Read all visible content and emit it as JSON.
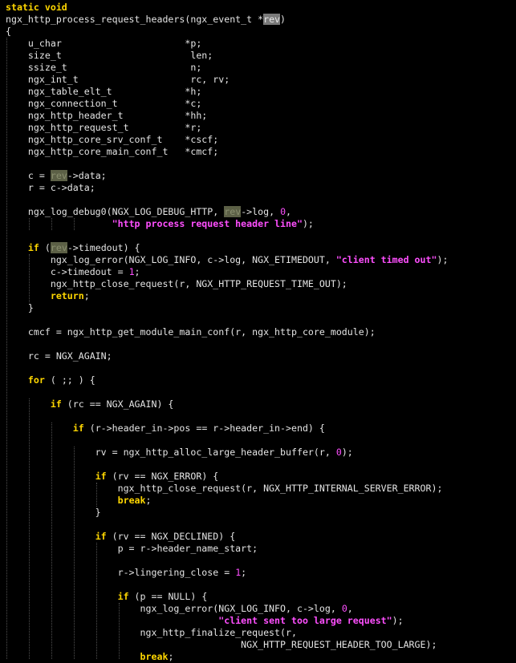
{
  "editor": {
    "language": "c",
    "colors": {
      "background": "#000000",
      "text": "#e4e4e4",
      "keyword": "#ffd700",
      "literal": "#ff4fff",
      "match_highlight": "#5c6046",
      "selection": "#7a7a7a"
    },
    "lines": [
      [
        [
          "static void",
          "kw"
        ]
      ],
      [
        [
          "ngx_http_process_request_headers(ngx_event_t *",
          ""
        ],
        [
          "rev",
          "sel"
        ],
        [
          ")",
          ""
        ]
      ],
      [
        [
          "{",
          ""
        ]
      ],
      [
        [
          "    u_char                      *p;",
          ""
        ]
      ],
      [
        [
          "    size_t                       len;",
          ""
        ]
      ],
      [
        [
          "    ssize_t                      n;",
          ""
        ]
      ],
      [
        [
          "    ngx_int_t                    rc, rv;",
          ""
        ]
      ],
      [
        [
          "    ngx_table_elt_t             *h;",
          ""
        ]
      ],
      [
        [
          "    ngx_connection_t            *c;",
          ""
        ]
      ],
      [
        [
          "    ngx_http_header_t           *hh;",
          ""
        ]
      ],
      [
        [
          "    ngx_http_request_t          *r;",
          ""
        ]
      ],
      [
        [
          "    ngx_http_core_srv_conf_t    *cscf;",
          ""
        ]
      ],
      [
        [
          "    ngx_http_core_main_conf_t   *cmcf;",
          ""
        ]
      ],
      [],
      [
        [
          "    c = ",
          ""
        ],
        [
          "rev",
          "hl"
        ],
        [
          "->data;",
          ""
        ]
      ],
      [
        [
          "    r = c->data;",
          ""
        ]
      ],
      [],
      [
        [
          "    ngx_log_debug0(NGX_LOG_DEBUG_HTTP, ",
          ""
        ],
        [
          "rev",
          "hl"
        ],
        [
          "->log, ",
          ""
        ],
        [
          "0",
          "num"
        ],
        [
          ",",
          ""
        ]
      ],
      [
        [
          "                   ",
          ""
        ],
        [
          "\"http process request header line\"",
          "str"
        ],
        [
          ");",
          ""
        ]
      ],
      [],
      [
        [
          "    ",
          ""
        ],
        [
          "if",
          "kw"
        ],
        [
          " (",
          ""
        ],
        [
          "rev",
          "hl"
        ],
        [
          "->timedout) {",
          ""
        ]
      ],
      [
        [
          "        ngx_log_error(NGX_LOG_INFO, c->log, NGX_ETIMEDOUT, ",
          ""
        ],
        [
          "\"client timed out\"",
          "str"
        ],
        [
          ");",
          ""
        ]
      ],
      [
        [
          "        c->timedout = ",
          ""
        ],
        [
          "1",
          "num"
        ],
        [
          ";",
          ""
        ]
      ],
      [
        [
          "        ngx_http_close_request(r, NGX_HTTP_REQUEST_TIME_OUT);",
          ""
        ]
      ],
      [
        [
          "        ",
          ""
        ],
        [
          "return",
          "kw"
        ],
        [
          ";",
          ""
        ]
      ],
      [
        [
          "    }",
          ""
        ]
      ],
      [],
      [
        [
          "    cmcf = ngx_http_get_module_main_conf(r, ngx_http_core_module);",
          ""
        ]
      ],
      [],
      [
        [
          "    rc = NGX_AGAIN;",
          ""
        ]
      ],
      [],
      [
        [
          "    ",
          ""
        ],
        [
          "for",
          "kw"
        ],
        [
          " ( ;; ) {",
          ""
        ]
      ],
      [],
      [
        [
          "        ",
          ""
        ],
        [
          "if",
          "kw"
        ],
        [
          " (rc == NGX_AGAIN) {",
          ""
        ]
      ],
      [],
      [
        [
          "            ",
          ""
        ],
        [
          "if",
          "kw"
        ],
        [
          " (r->header_in->pos == r->header_in->end) {",
          ""
        ]
      ],
      [],
      [
        [
          "                rv = ngx_http_alloc_large_header_buffer(r, ",
          ""
        ],
        [
          "0",
          "num"
        ],
        [
          ");",
          ""
        ]
      ],
      [],
      [
        [
          "                ",
          ""
        ],
        [
          "if",
          "kw"
        ],
        [
          " (rv == NGX_ERROR) {",
          ""
        ]
      ],
      [
        [
          "                    ngx_http_close_request(r, NGX_HTTP_INTERNAL_SERVER_ERROR);",
          ""
        ]
      ],
      [
        [
          "                    ",
          ""
        ],
        [
          "break",
          "kw"
        ],
        [
          ";",
          ""
        ]
      ],
      [
        [
          "                }",
          ""
        ]
      ],
      [],
      [
        [
          "                ",
          ""
        ],
        [
          "if",
          "kw"
        ],
        [
          " (rv == NGX_DECLINED) {",
          ""
        ]
      ],
      [
        [
          "                    p = r->header_name_start;",
          ""
        ]
      ],
      [],
      [
        [
          "                    r->lingering_close = ",
          ""
        ],
        [
          "1",
          "num"
        ],
        [
          ";",
          ""
        ]
      ],
      [],
      [
        [
          "                    ",
          ""
        ],
        [
          "if",
          "kw"
        ],
        [
          " (p == NULL) {",
          ""
        ]
      ],
      [
        [
          "                        ngx_log_error(NGX_LOG_INFO, c->log, ",
          ""
        ],
        [
          "0",
          "num"
        ],
        [
          ",",
          ""
        ]
      ],
      [
        [
          "                                      ",
          ""
        ],
        [
          "\"client sent too large request\"",
          "str"
        ],
        [
          ");",
          ""
        ]
      ],
      [
        [
          "                        ngx_http_finalize_request(r,",
          ""
        ]
      ],
      [
        [
          "                                          NGX_HTTP_REQUEST_HEADER_TOO_LARGE);",
          ""
        ]
      ],
      [
        [
          "                        ",
          ""
        ],
        [
          "break",
          "kw"
        ],
        [
          ";",
          ""
        ]
      ]
    ]
  }
}
